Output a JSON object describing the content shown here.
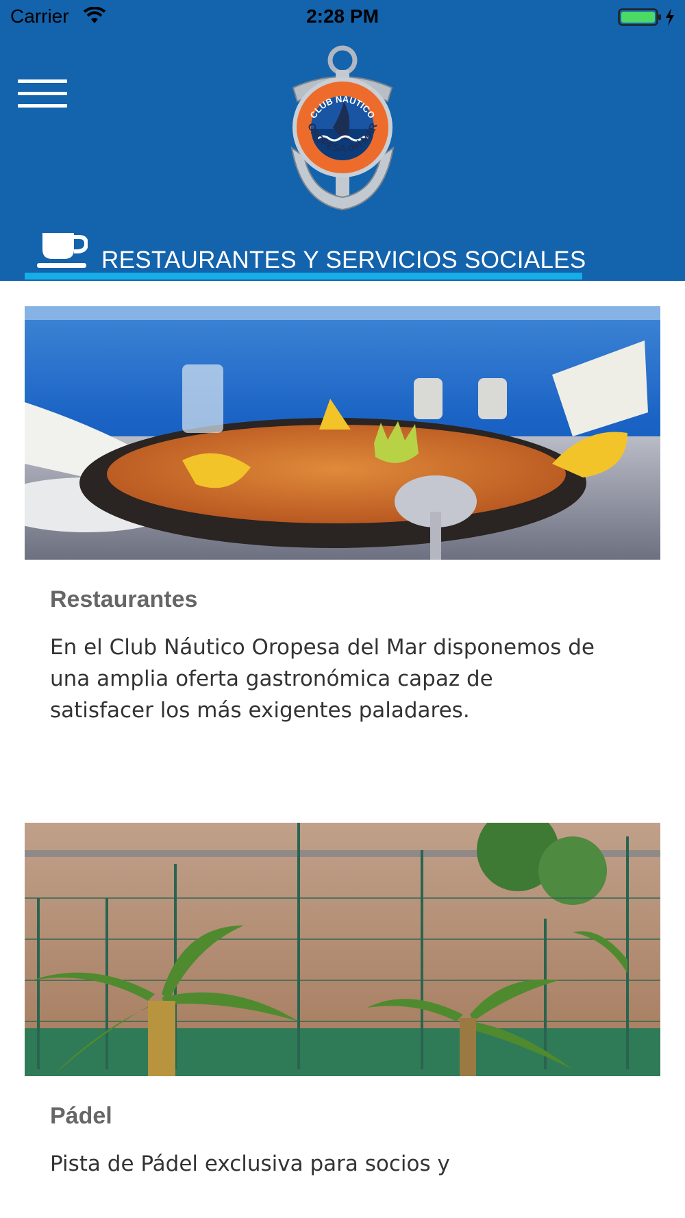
{
  "status_bar": {
    "carrier": "Carrier",
    "time": "2:28 PM",
    "battery_color": "#4cd964"
  },
  "header": {
    "background": "#1463ad",
    "logo": {
      "top_text": "CLUB NAUTICO",
      "bottom_text": "OROPESA del MAR"
    },
    "section_title": "RESTAURANTES Y SERVICIOS SOCIALES",
    "underline_color": "#15aee8"
  },
  "cards": [
    {
      "title": "Restaurantes",
      "text": "En el Club Náutico Oropesa del Mar disponemos de una amplia oferta gastronómica capaz de satisfacer los más exigentes paladares."
    },
    {
      "title": "Pádel",
      "text": "Pista de Pádel exclusiva para socios y"
    }
  ]
}
